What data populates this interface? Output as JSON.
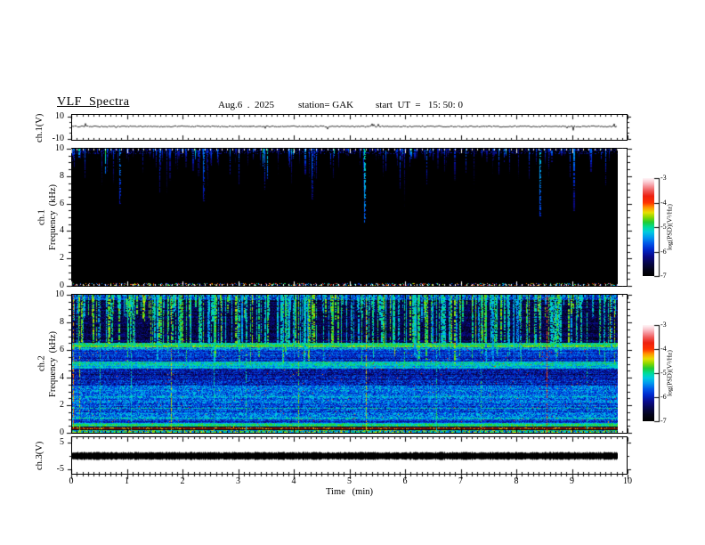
{
  "header": {
    "title": "VLF  Spectra",
    "date": "Aug.6  .  2025",
    "station": "station= GAK",
    "start_ut": "start  UT  =   15: 50: 0"
  },
  "chart_data": {
    "type": "heatmap",
    "subtype": "vlf-multipanel-spectrogram",
    "title": "VLF Spectra",
    "date": "Aug.6 . 2025",
    "station": "GAK",
    "start_ut": "15:50:0",
    "x": {
      "label": "Time   (min)",
      "range": [
        0,
        10
      ],
      "ticks": [
        "0",
        "1",
        "2",
        "3",
        "4",
        "5",
        "6",
        "7",
        "8",
        "9",
        "10"
      ],
      "tick_values": [
        0,
        1,
        2,
        3,
        4,
        5,
        6,
        7,
        8,
        9,
        10
      ],
      "minor_step_min": 0.1,
      "data_end_min": 9.8
    },
    "colormap": {
      "stops": [
        [
          0.0,
          "#000000"
        ],
        [
          0.06,
          "#030318"
        ],
        [
          0.13,
          "#06064a"
        ],
        [
          0.2,
          "#0a0a8a"
        ],
        [
          0.27,
          "#0028cc"
        ],
        [
          0.33,
          "#0055e8"
        ],
        [
          0.39,
          "#0095f0"
        ],
        [
          0.45,
          "#00cce0"
        ],
        [
          0.5,
          "#00dd99"
        ],
        [
          0.55,
          "#22cc33"
        ],
        [
          0.6,
          "#88d800"
        ],
        [
          0.65,
          "#e8e000"
        ],
        [
          0.7,
          "#ff9900"
        ],
        [
          0.75,
          "#ff3300"
        ],
        [
          0.82,
          "#ee2211"
        ],
        [
          0.88,
          "#f06060"
        ],
        [
          0.93,
          "#f8a0a8"
        ],
        [
          0.97,
          "#fcd4da"
        ],
        [
          1.0,
          "#fff2f4"
        ]
      ]
    },
    "panels": [
      {
        "id": "ch1_voltage",
        "kind": "line",
        "ylabel": "ch.1(V)",
        "yrange": [
          -12,
          12
        ],
        "ytick_values": [
          10,
          -10
        ],
        "ytick_labels": [
          "10",
          "-10"
        ],
        "signal": {
          "description": "quiet flat trace near 0 V with small noise",
          "baseline_v": 0.5,
          "noise_v": 0.5,
          "spike_v": 2.5
        }
      },
      {
        "id": "ch1_spectrogram",
        "kind": "spectrogram",
        "ylabel_top": "ch.1",
        "ylabel": "Frequency  (kHz)",
        "yrange": [
          0,
          10
        ],
        "ytick_values": [
          0,
          2,
          4,
          6,
          8,
          10
        ],
        "ytick_labels": [
          "0",
          "2",
          "4",
          "6",
          "8",
          "10"
        ],
        "minor_tick_khz": 0.5,
        "render": {
          "background_level": -7,
          "top_speckle": {
            "f_min": 9.7,
            "density": 0.28,
            "level_min": -6.6,
            "level_max": -6.0
          },
          "streaks": {
            "count": 150,
            "depth_khz_min": 0.5,
            "depth_khz_max": 3.2,
            "deep_fraction": 0.12,
            "deep_extra_khz": 2.5,
            "level_min": -6.5,
            "level_max": -5.8,
            "bright_fraction": 0.08,
            "bright_level": -5.2,
            "pixel_density": 0.8
          },
          "notable_streaks": [
            {
              "time_min": 5.25,
              "f_bottom": 4.6,
              "level": -5.0
            },
            {
              "time_min": 8.4,
              "f_bottom": 5.0,
              "level": -5.2
            },
            {
              "time_min": 0.85,
              "f_bottom": 6.0,
              "level": -5.4
            },
            {
              "time_min": 2.35,
              "f_bottom": 6.2,
              "level": -5.5
            },
            {
              "time_min": 4.3,
              "f_bottom": 6.3,
              "level": -5.6
            }
          ],
          "bottom_speckle": {
            "f_max": 0.2,
            "density": 0.3
          }
        }
      },
      {
        "id": "ch2_spectrogram",
        "kind": "spectrogram",
        "ylabel_top": "ch.2",
        "ylabel": "Frequency  (kHz)",
        "yrange": [
          0,
          10
        ],
        "ytick_values": [
          0,
          2,
          4,
          6,
          8,
          10
        ],
        "ytick_labels": [
          "0",
          "2",
          "4",
          "6",
          "8",
          "10"
        ],
        "minor_tick_khz": 0.5,
        "render": {
          "bands": [
            {
              "f": [
                0.0,
                0.15
              ],
              "level": -5.0,
              "noise": 1.0
            },
            {
              "f": [
                0.15,
                0.2
              ],
              "level": -6.8,
              "noise": 0.2
            },
            {
              "f": [
                0.2,
                0.33
              ],
              "level": -4.2,
              "noise": 0.15,
              "color": "#7a1400"
            },
            {
              "f": [
                0.33,
                0.42
              ],
              "level": -6.6,
              "noise": 0.3
            },
            {
              "f": [
                0.42,
                0.65
              ],
              "level": -5.0,
              "noise": 0.45
            },
            {
              "f": [
                0.65,
                0.9
              ],
              "level": -5.9,
              "noise": 0.5
            },
            {
              "f": [
                0.9,
                1.15
              ],
              "level": -5.4,
              "noise": 0.6
            },
            {
              "f": [
                1.15,
                2.3
              ],
              "level": -5.7,
              "noise": 0.6
            },
            {
              "f": [
                2.3,
                3.4
              ],
              "level": -5.6,
              "noise": 0.6
            },
            {
              "f": [
                3.4,
                4.6
              ],
              "level": -6.0,
              "noise": 0.6
            },
            {
              "f": [
                4.6,
                4.9
              ],
              "level": -5.3,
              "noise": 0.5
            },
            {
              "f": [
                4.9,
                5.15
              ],
              "level": -5.2,
              "noise": 0.5
            },
            {
              "f": [
                5.15,
                5.95
              ],
              "level": -5.9,
              "noise": 0.5
            },
            {
              "f": [
                5.95,
                6.15
              ],
              "level": -5.6,
              "noise": 0.5
            },
            {
              "f": [
                6.15,
                6.5
              ],
              "level": -4.9,
              "noise": 0.45
            },
            {
              "f": [
                6.5,
                9.6
              ],
              "level": -6.5,
              "noise": 0.45
            },
            {
              "f": [
                9.6,
                10.0
              ],
              "level": -5.8,
              "noise": 0.7
            }
          ],
          "horizontal_lines": [
            {
              "f": 6.32,
              "level": -4.8,
              "density": 0.85
            },
            {
              "f": 6.05,
              "level": -5.0,
              "density": 0.6
            },
            {
              "f": 4.95,
              "level": -4.9,
              "density": 0.7
            },
            {
              "f": 4.7,
              "level": -5.1,
              "density": 0.5
            },
            {
              "f": 2.55,
              "level": -5.1,
              "density": 0.5
            },
            {
              "f": 2.17,
              "level": -5.2,
              "density": 0.45
            },
            {
              "f": 1.72,
              "level": -5.0,
              "density": 0.55
            },
            {
              "f": 1.34,
              "level": -5.2,
              "density": 0.45
            },
            {
              "f": 1.02,
              "level": -5.0,
              "density": 0.5
            },
            {
              "f": 0.55,
              "level": -4.9,
              "density": 0.7
            }
          ],
          "streaks": {
            "count": 420,
            "f_bottom_typ": 6.45,
            "mid_fraction": 0.35,
            "f_bottom_mid": 8.0,
            "deep_fraction": 0.15,
            "f_bottom_deep": 4.7,
            "level_min": -5.5,
            "level_max": -4.6,
            "pixel_density": 0.7
          },
          "full_height_lines": [
            {
              "time_min": 0.02,
              "level": -4.3
            },
            {
              "time_min": 0.12,
              "level": -4.6
            },
            {
              "time_min": 0.5,
              "level": -5.0
            },
            {
              "time_min": 1.05,
              "level": -5.1
            },
            {
              "time_min": 1.78,
              "level": -4.5
            },
            {
              "time_min": 2.55,
              "level": -5.0
            },
            {
              "time_min": 3.12,
              "level": -5.1
            },
            {
              "time_min": 4.07,
              "level": -4.7
            },
            {
              "time_min": 5.28,
              "level": -4.4
            },
            {
              "time_min": 6.55,
              "level": -5.0
            },
            {
              "time_min": 7.35,
              "level": -4.9
            },
            {
              "time_min": 8.52,
              "level": -3.9
            },
            {
              "time_min": 9.25,
              "level": -5.0
            }
          ],
          "red_specks": {
            "count": 260,
            "level_min": -4.2,
            "level_max": -3.6,
            "f_max": 6.8
          }
        }
      },
      {
        "id": "ch3_voltage",
        "kind": "line",
        "ylabel": "ch.3(V)",
        "yrange": [
          -7.5,
          7.5
        ],
        "ytick_values": [
          5,
          -5
        ],
        "ytick_labels": [
          "5",
          "-5"
        ],
        "signal": {
          "description": "dense saturated oscillation band around 0 V",
          "band_halfwidth_v": 1.4
        }
      }
    ],
    "colorbars": [
      {
        "label": "log(PSD)(V²/Hz)",
        "range": [
          -7,
          -3
        ],
        "ticks": [
          "-3",
          "-4",
          "-5",
          "-6",
          "-7"
        ]
      },
      {
        "label": "log(PSD)(V²/Hz)",
        "range": [
          -7,
          -3
        ],
        "ticks": [
          "-3",
          "-4",
          "-5",
          "-6",
          "-7"
        ]
      }
    ],
    "legend_position": "right",
    "grid": false
  }
}
